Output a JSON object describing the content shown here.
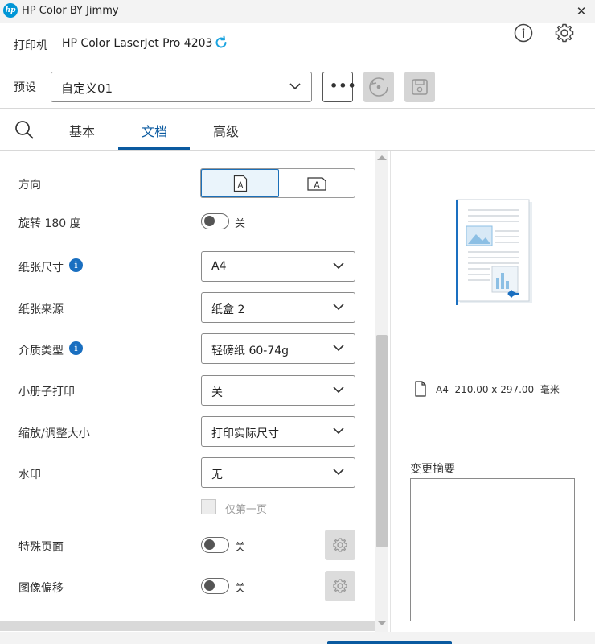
{
  "window": {
    "title": "HP Color BY Jimmy",
    "logo_text": "hp",
    "close": "✕"
  },
  "header": {
    "printer_label": "打印机",
    "printer_name": "HP Color LaserJet Pro 4203",
    "preset_label": "预设",
    "preset_value": "自定义01",
    "more_label": "•••"
  },
  "tabs": [
    {
      "label": "基本",
      "active": false
    },
    {
      "label": "文档",
      "active": true
    },
    {
      "label": "高级",
      "active": false
    }
  ],
  "form": {
    "orientation": {
      "label": "方向",
      "selected": "portrait"
    },
    "rotate": {
      "label": "旋转 180 度",
      "state": "关"
    },
    "paper_size": {
      "label": "纸张尺寸",
      "value": "A4"
    },
    "paper_source": {
      "label": "纸张来源",
      "value": "纸盒 2"
    },
    "media_type": {
      "label": "介质类型",
      "value": "轻磅纸 60-74g"
    },
    "booklet": {
      "label": "小册子打印",
      "value": "关"
    },
    "scale": {
      "label": "缩放/调整大小",
      "value": "打印实际尺寸"
    },
    "watermark": {
      "label": "水印",
      "value": "无",
      "first_page_only": "仅第一页"
    },
    "special_pages": {
      "label": "特殊页面",
      "state": "关"
    },
    "image_shift": {
      "label": "图像偏移",
      "state": "关"
    }
  },
  "preview": {
    "paper_code": "A4",
    "paper_dims": "210.00 x 297.00",
    "paper_unit": "毫米",
    "summary_label": "变更摘要"
  },
  "colors": {
    "accent": "#0a5aa0",
    "info": "#1a6fc0",
    "hp_blue": "#0096d6"
  }
}
